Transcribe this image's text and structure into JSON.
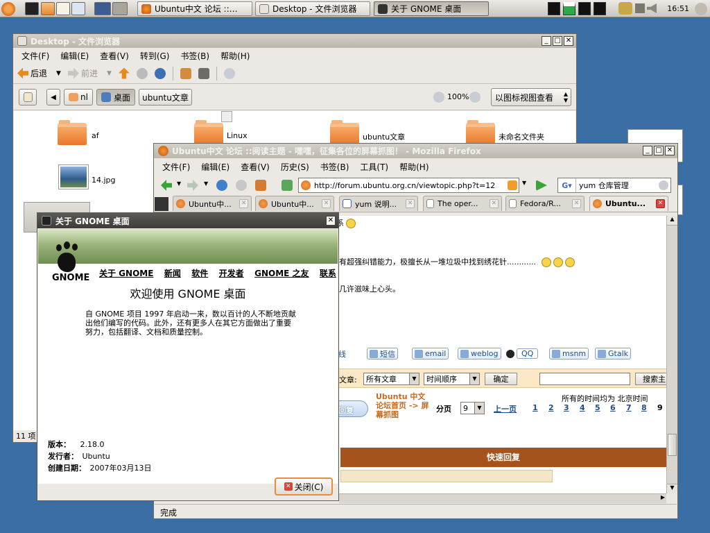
{
  "panel": {
    "tasks": [
      {
        "label": "Ubuntu中文 论坛 ::…",
        "active": false
      },
      {
        "label": "Desktop - 文件浏览器",
        "active": false
      },
      {
        "label": "关于 GNOME 桌面",
        "active": true
      }
    ],
    "clock": "16:51"
  },
  "nautilus": {
    "title": "Desktop - 文件浏览器",
    "menu": [
      "文件(F)",
      "编辑(E)",
      "查看(V)",
      "转到(G)",
      "书签(B)",
      "帮助(H)"
    ],
    "back": "后退",
    "forward": "前进",
    "path": [
      "nl",
      "桌面",
      "ubuntu文章"
    ],
    "zoom": "100%",
    "view_mode": "以图标视图查看",
    "items": [
      {
        "name": "af"
      },
      {
        "name": "Linux"
      },
      {
        "name": "ubuntu文章"
      },
      {
        "name": "未命名文件夹"
      },
      {
        "name": "14.jpg"
      }
    ],
    "status": "11 项"
  },
  "firefox": {
    "title": "Ubuntu中文 论坛 ::阅读主题 - 嘿嘿，征集各位的屏幕抓图！ - Mozilla Firefox",
    "menu": [
      "文件(F)",
      "编辑(E)",
      "查看(V)",
      "历史(S)",
      "书签(B)",
      "工具(T)",
      "帮助(H)"
    ],
    "url": "http://forum.ubuntu.org.cn/viewtopic.php?t=12",
    "search_value": "yum 仓库管理",
    "tabs": [
      {
        "label": "Ubuntu中..."
      },
      {
        "label": "Ubuntu中..."
      },
      {
        "label": "yum 说明..."
      },
      {
        "label": "The oper..."
      },
      {
        "label": "Fedora/R..."
      },
      {
        "label": "Ubuntu..."
      }
    ],
    "status": "完成",
    "page": {
      "line1": "系",
      "line2": "有超强纠错能力，极擅长从一堆垃圾中找到绣花针............",
      "line3": "几许滋味上心头。",
      "contact_btns": [
        "线",
        "短信",
        "email",
        "weblog",
        "QQ",
        "msnm",
        "Gtalk"
      ],
      "filter_label": "文章:",
      "filter_posts": "所有文章",
      "filter_order": "时间顺序",
      "go": "确定",
      "search_btn": "搜索主",
      "reply_btn": "回复",
      "breadcrumb": "Ubuntu 中文 论坛首页 -> 屏幕抓图",
      "page_label": "分页",
      "page_select": "9",
      "prev": "上一页",
      "pages": [
        "1",
        "2",
        "3",
        "4",
        "5",
        "6",
        "7",
        "8",
        "9"
      ],
      "timezone": "所有的时间均为 北京时间",
      "quick_reply": "快速回复"
    }
  },
  "about": {
    "title": "关于 GNOME 桌面",
    "logo_text": "GNOME",
    "nav": [
      "关于 GNOME",
      "新闻",
      "软件",
      "开发者",
      "GNOME 之友",
      "联系"
    ],
    "heading": "欢迎使用 GNOME 桌面",
    "body": "自 GNOME 项目 1997 年启动一来，数以百计的人不断地贡献出他们编写的代码。此外，还有更多人在其它方面做出了重要努力，包括翻译、文档和质量控制。",
    "version_label": "版本：",
    "version": "2.18.0",
    "distributor_label": "发行者：",
    "distributor": "Ubuntu",
    "date_label": "创建日期：",
    "date": "2007年03月13日",
    "close": "关闭(C)"
  }
}
